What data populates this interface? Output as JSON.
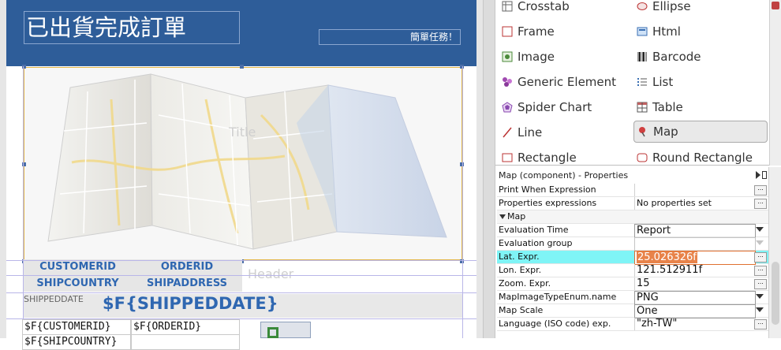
{
  "report": {
    "title": "已出貨完成訂單",
    "subtitle": "簡單任務！",
    "band_labels": {
      "title": "Title",
      "header": "Header"
    },
    "column_headers": {
      "customerid": "CUSTOMERID",
      "orderid": "ORDERID",
      "shipcountry": "SHIPCOUNTRY",
      "shipaddress": "SHIPADDRESS"
    },
    "shippeddate_label": "SHIPPEDDATE",
    "shippeddate_field": "$F{SHIPPEDDATE}",
    "detail_fields": {
      "customerid": "$F{CUSTOMERID}",
      "orderid": "$F{ORDERID}",
      "shipcountry": "$F{SHIPCOUNTRY}"
    }
  },
  "palette": {
    "items": [
      {
        "label": "Crosstab",
        "icon": "crosstab-icon"
      },
      {
        "label": "Ellipse",
        "icon": "ellipse-icon"
      },
      {
        "label": "Frame",
        "icon": "frame-icon"
      },
      {
        "label": "Html",
        "icon": "html-icon"
      },
      {
        "label": "Image",
        "icon": "image-icon"
      },
      {
        "label": "Barcode",
        "icon": "barcode-icon"
      },
      {
        "label": "Generic Element",
        "icon": "generic-element-icon"
      },
      {
        "label": "List",
        "icon": "list-icon"
      },
      {
        "label": "Spider Chart",
        "icon": "spider-chart-icon"
      },
      {
        "label": "Table",
        "icon": "table-icon"
      },
      {
        "label": "Line",
        "icon": "line-icon"
      },
      {
        "label": "Map",
        "icon": "map-pin-icon",
        "selected": true
      },
      {
        "label": "Rectangle",
        "icon": "rectangle-icon"
      },
      {
        "label": "Round Rectangle",
        "icon": "round-rectangle-icon"
      }
    ]
  },
  "properties": {
    "title": "Map (component) - Properties",
    "rows": [
      {
        "name": "Print When Expression",
        "value": ""
      },
      {
        "name": "Properties expressions",
        "value": "No properties set"
      },
      {
        "name": "Map",
        "value": ""
      },
      {
        "name": "Evaluation Time",
        "value": "Report"
      },
      {
        "name": "Evaluation group",
        "value": ""
      },
      {
        "name": "Lat. Expr.",
        "value": "25.026326f"
      },
      {
        "name": "Lon. Expr.",
        "value": "121.512911f"
      },
      {
        "name": "Zoom. Expr.",
        "value": "15"
      },
      {
        "name": "MapImageTypeEnum.name",
        "value": "PNG"
      },
      {
        "name": "Map Scale",
        "value": "One"
      },
      {
        "name": "Language (ISO code) exp.",
        "value": "\"zh-TW\""
      }
    ],
    "button_label": "...",
    "highlight_color": "#7ff4f6"
  },
  "colors": {
    "title_band": "#2e5d99",
    "header_text": "#2f67b1",
    "selection_border": "#e3b84a"
  }
}
